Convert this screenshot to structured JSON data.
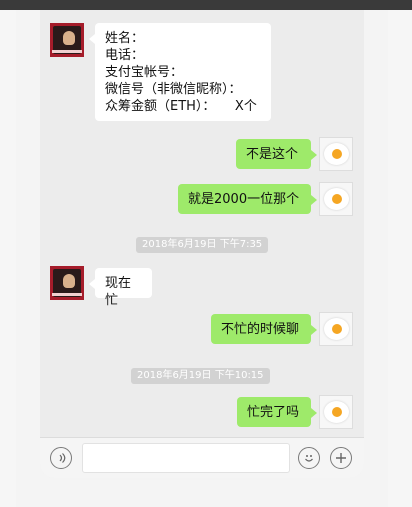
{
  "chat": {
    "incoming_form": {
      "lines": [
        "姓名：",
        "电话：",
        "支付宝帐号：",
        "微信号（非微信昵称）：",
        "众筹金额（ETH）：　　X个"
      ]
    },
    "messages": {
      "out1": "不是这个",
      "out2": "就是2000一位那个",
      "in2": "现在忙",
      "out3": "不忙的时候聊",
      "out4": "忙完了吗"
    },
    "timestamps": {
      "t1": "2018年6月19日 下午7:35",
      "t2": "2018年6月19日 下午10:15"
    }
  },
  "input_bar": {
    "voice_icon": "voice-icon",
    "emoji_icon": "emoji-icon",
    "add_icon": "plus-icon"
  },
  "colors": {
    "outgoing_bubble": "#9eea6a",
    "incoming_bubble": "#ffffff",
    "timestamp_bg": "#d2d2d2"
  }
}
